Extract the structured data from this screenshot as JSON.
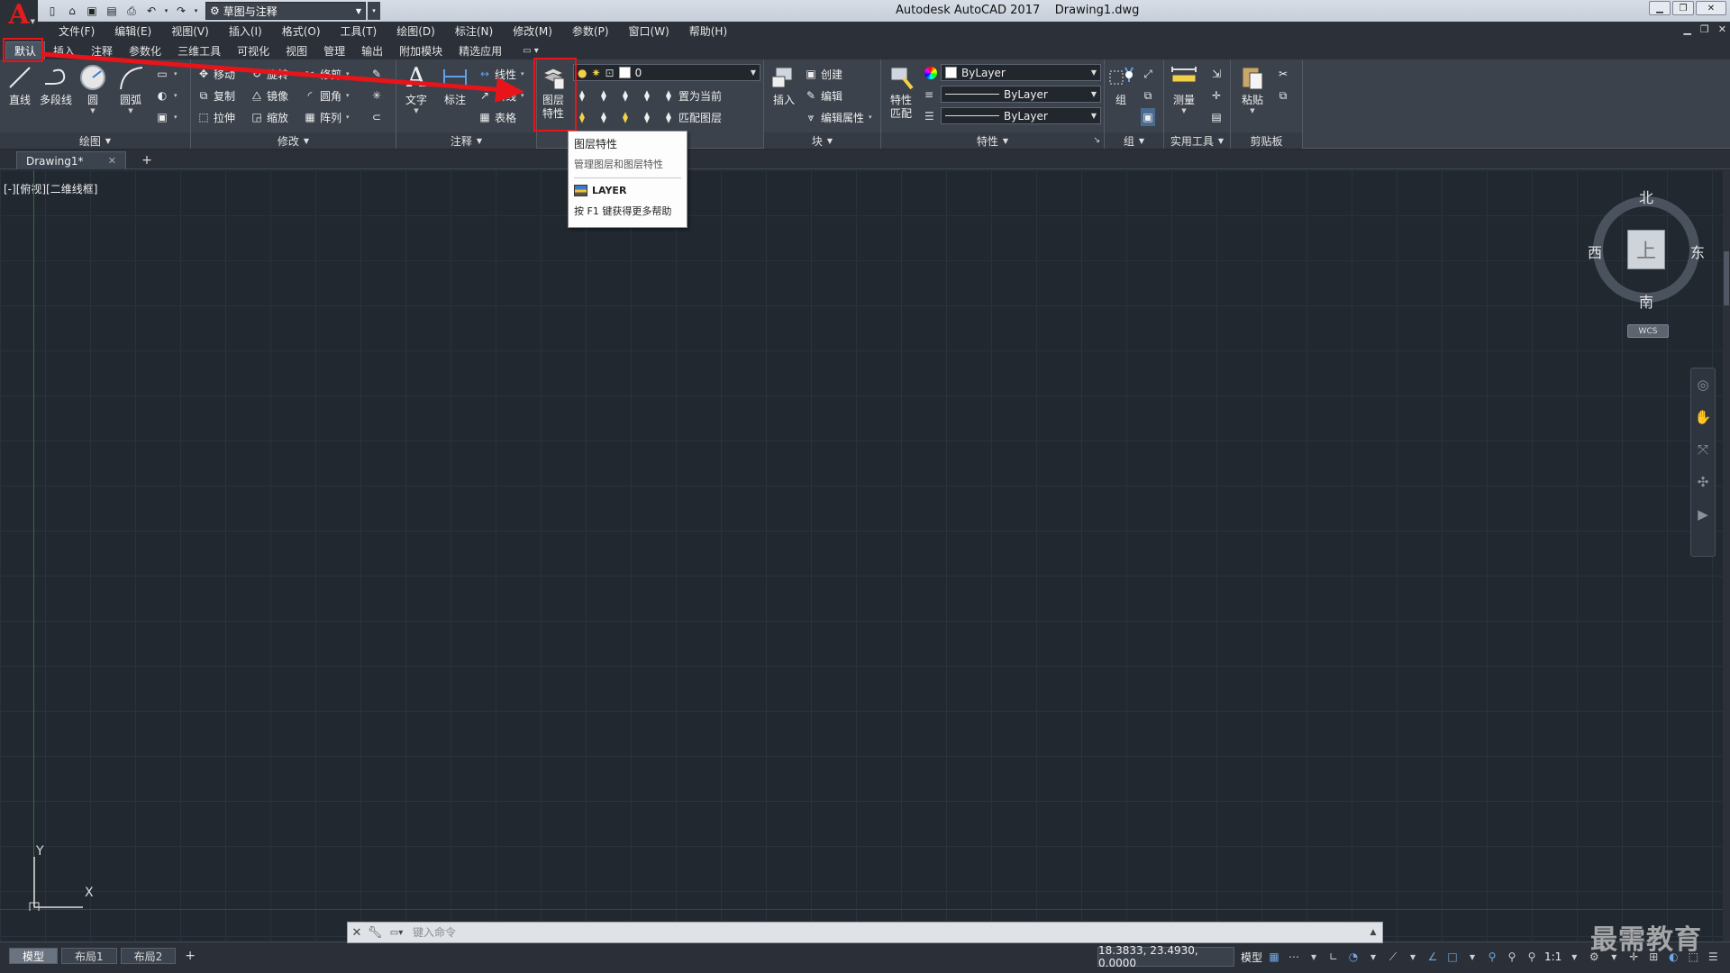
{
  "window": {
    "title": "Autodesk AutoCAD 2017    Drawing1.dwg",
    "workspace": "草图与注释",
    "logo_letter": "A"
  },
  "menu": [
    "文件(F)",
    "编辑(E)",
    "视图(V)",
    "插入(I)",
    "格式(O)",
    "工具(T)",
    "绘图(D)",
    "标注(N)",
    "修改(M)",
    "参数(P)",
    "窗口(W)",
    "帮助(H)"
  ],
  "ribbon_tabs": [
    "默认",
    "插入",
    "注释",
    "参数化",
    "三维工具",
    "可视化",
    "视图",
    "管理",
    "输出",
    "附加模块",
    "精选应用"
  ],
  "ribbon": {
    "draw": {
      "title": "绘图",
      "line": "直线",
      "polyline": "多段线",
      "circle": "圆",
      "arc": "圆弧"
    },
    "modify": {
      "title": "修改",
      "move": "移动",
      "rotate": "旋转",
      "trim": "修剪",
      "copy": "复制",
      "mirror": "镜像",
      "fillet": "圆角",
      "stretch": "拉伸",
      "scale": "缩放",
      "array": "阵列"
    },
    "annotation": {
      "title": "注释",
      "text": "文字",
      "dimension": "标注",
      "linear": "线性",
      "leader": "引线",
      "table": "表格"
    },
    "layers": {
      "layer_props_line1": "图层",
      "layer_props_line2": "特性",
      "current_layer": "0",
      "set_current": "置为当前",
      "match_layer": "匹配图层"
    },
    "block": {
      "title": "块",
      "insert": "插入",
      "create": "创建",
      "edit": "编辑",
      "edit_attr": "编辑属性"
    },
    "properties": {
      "title": "特性",
      "match_line1": "特性",
      "match_line2": "匹配",
      "color": "ByLayer",
      "linetype": "ByLayer",
      "lineweight": "ByLayer"
    },
    "groups": {
      "title": "组",
      "group": "组"
    },
    "utilities": {
      "title": "实用工具",
      "measure": "测量"
    },
    "clipboard": {
      "title": "剪贴板",
      "paste": "粘贴"
    }
  },
  "file_tab": {
    "name": "Drawing1*"
  },
  "viewport": {
    "label": "[-][俯视][二维线框]",
    "axis_y": "Y",
    "axis_x": "X"
  },
  "viewcube": {
    "north": "北",
    "south": "南",
    "east": "东",
    "west": "西",
    "top": "上",
    "wcs": "WCS"
  },
  "tooltip": {
    "title": "图层特性",
    "description": "管理图层和图层特性",
    "command": "LAYER",
    "help": "按 F1 键获得更多帮助"
  },
  "command_line": {
    "placeholder": "键入命令"
  },
  "status": {
    "layout_tabs": [
      "模型",
      "布局1",
      "布局2"
    ],
    "coords": "18.3833, 23.4930, 0.0000",
    "model": "模型",
    "scale": "1:1"
  },
  "watermark": "最需教育",
  "colors": {
    "highlight": "#e8141a",
    "canvas": "#212830",
    "ribbon": "#3b424c"
  }
}
